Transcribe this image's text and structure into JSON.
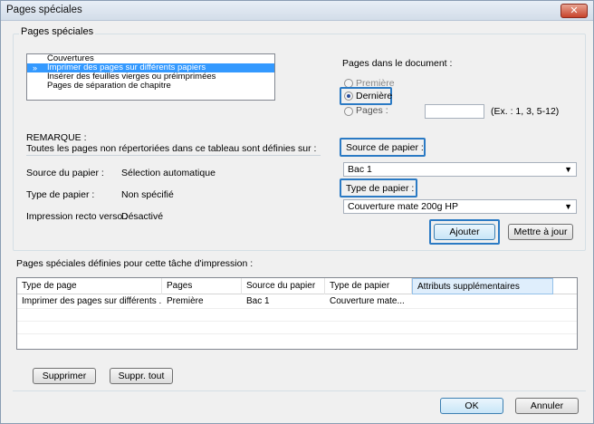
{
  "window": {
    "title": "Pages spéciales",
    "close_glyph": "✕"
  },
  "group": {
    "title": "Pages spéciales"
  },
  "list": {
    "items": [
      "Couvertures",
      "Imprimer des pages sur différents papiers",
      "Insérer des feuilles vierges ou préimprimées",
      "Pages de séparation de chapitre"
    ],
    "selected_arrow": "»"
  },
  "pages_doc": {
    "label": "Pages dans le document :",
    "opt_first": "Première",
    "opt_last": "Dernière",
    "opt_pages": "Pages :",
    "pages_value": "",
    "example": "(Ex. : 1, 3, 5-12)"
  },
  "remarque": {
    "title": "REMARQUE :",
    "text": "Toutes les pages non répertoriées dans ce tableau sont définies sur :",
    "rows": [
      {
        "label": "Source du papier :",
        "value": "Sélection automatique"
      },
      {
        "label": "Type de papier :",
        "value": "Non spécifié"
      },
      {
        "label": "Impression recto verso :",
        "value": "Désactivé"
      }
    ]
  },
  "source": {
    "label": "Source de papier :",
    "value": "Bac 1"
  },
  "type": {
    "label": "Type de papier :",
    "value": "Couverture mate 200g HP"
  },
  "buttons": {
    "add": "Ajouter",
    "update": "Mettre à jour",
    "delete": "Supprimer",
    "delete_all": "Suppr. tout",
    "ok": "OK",
    "cancel": "Annuler"
  },
  "table": {
    "caption": "Pages spéciales définies pour cette tâche d'impression :",
    "headers": [
      "Type de page",
      "Pages",
      "Source du papier",
      "Type de papier",
      "Attributs supplémentaires"
    ],
    "rows": [
      [
        "Imprimer des pages sur différents ...",
        "Première",
        "Bac 1",
        "Couverture mate...",
        ""
      ]
    ]
  }
}
